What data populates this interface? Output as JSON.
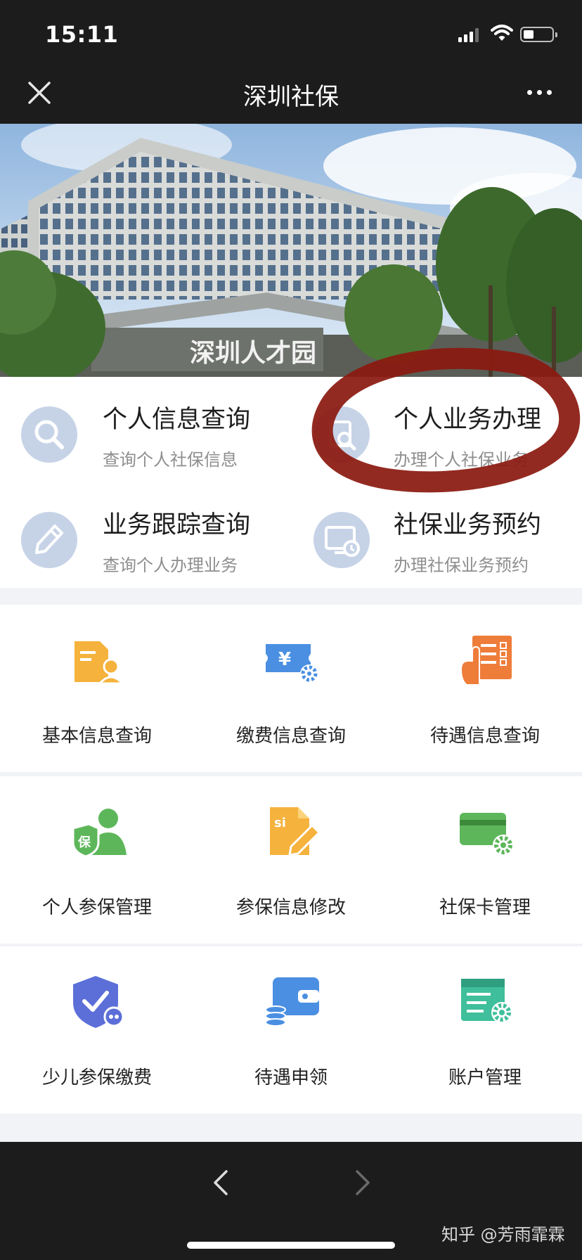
{
  "status_bar": {
    "time": "15:11"
  },
  "nav": {
    "title": "深圳社保"
  },
  "banner": {
    "sign_text": "深圳人才园"
  },
  "quick_services": [
    {
      "title": "个人信息查询",
      "subtitle": "查询个人社保信息",
      "icon": "search-icon"
    },
    {
      "title": "个人业务办理",
      "subtitle": "办理个人社保业务",
      "icon": "search-doc-icon"
    },
    {
      "title": "业务跟踪查询",
      "subtitle": "查询个人办理业务",
      "icon": "pencil-icon"
    },
    {
      "title": "社保业务预约",
      "subtitle": "办理社保业务预约",
      "icon": "monitor-clock-icon"
    }
  ],
  "grid": [
    {
      "label": "基本信息查询",
      "icon": "profile-card-icon",
      "color": "#f5b23c"
    },
    {
      "label": "缴费信息查询",
      "icon": "yen-ticket-icon",
      "color": "#4a8fe2"
    },
    {
      "label": "待遇信息查询",
      "icon": "checklist-hand-icon",
      "color": "#ef7d3a"
    },
    {
      "label": "个人参保管理",
      "icon": "insured-person-icon",
      "color": "#5db75a"
    },
    {
      "label": "参保信息修改",
      "icon": "si-edit-icon",
      "color": "#f5b23c"
    },
    {
      "label": "社保卡管理",
      "icon": "card-gear-icon",
      "color": "#5db75a"
    },
    {
      "label": "少儿参保缴费",
      "icon": "shield-check-icon",
      "color": "#5c6fd8"
    },
    {
      "label": "待遇申领",
      "icon": "wallet-coins-icon",
      "color": "#4a8fe2"
    },
    {
      "label": "账户管理",
      "icon": "list-gear-icon",
      "color": "#3fbf9b"
    }
  ],
  "annotation": {
    "color": "#8b1a10"
  },
  "watermark": "知乎 @芳雨霏霖"
}
